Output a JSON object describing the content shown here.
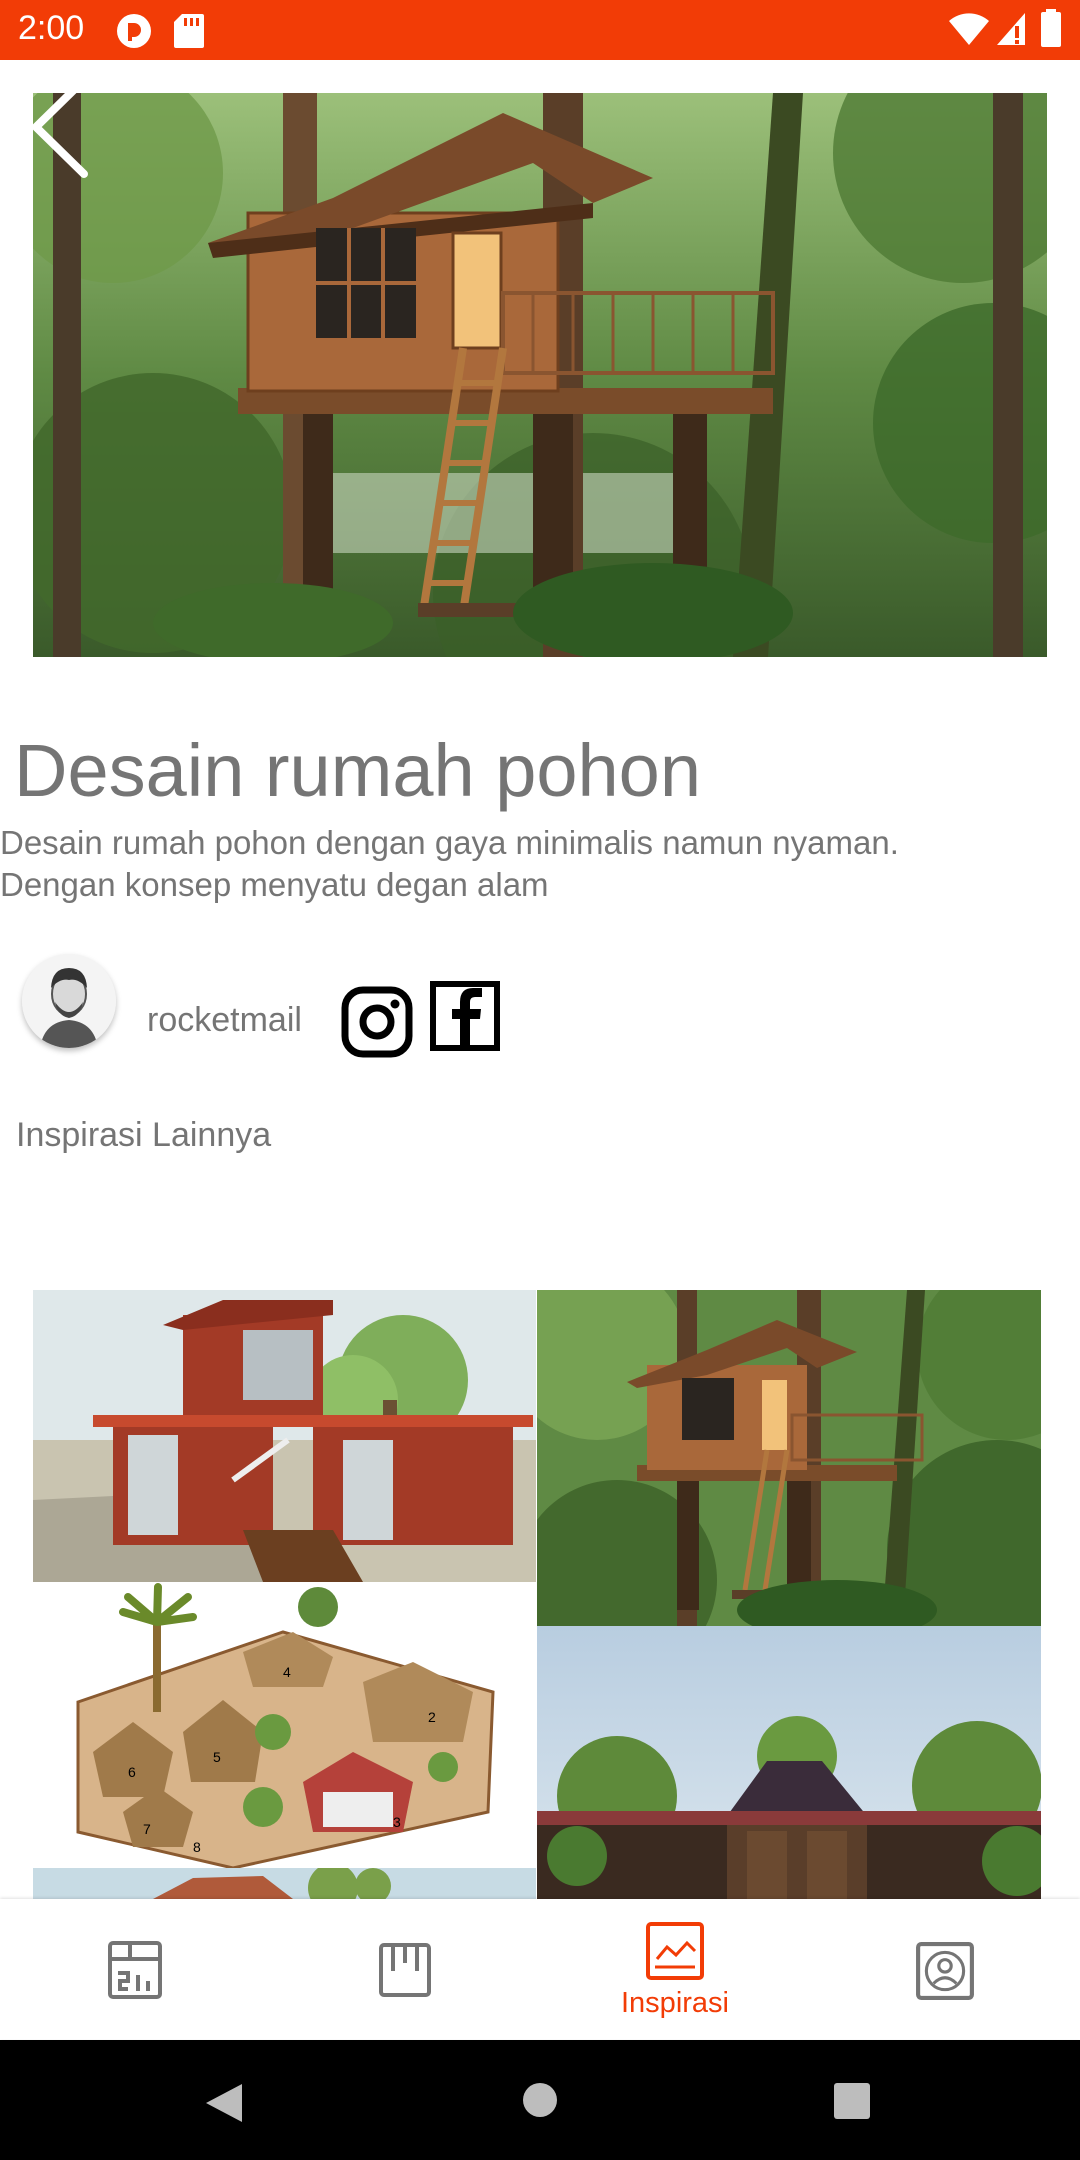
{
  "status_bar": {
    "time": "2:00",
    "background": "#f23c06",
    "left_icons": [
      "app-notification-icon",
      "sd-card-icon"
    ],
    "right_icons": [
      "wifi-icon",
      "cell-signal-icon",
      "battery-icon"
    ]
  },
  "detail": {
    "title": "Desain rumah pohon",
    "description_line1": "Desain rumah pohon dengan gaya minimalis namun nyaman.",
    "description_line2": "Dengan konsep menyatu degan alam",
    "author": "rocketmail",
    "social": [
      "instagram-icon",
      "facebook-icon"
    ]
  },
  "section": {
    "other_inspirations": "Inspirasi Lainnya"
  },
  "bottom_nav": {
    "items": [
      {
        "icon": "dashboard-icon",
        "label": ""
      },
      {
        "icon": "board-icon",
        "label": ""
      },
      {
        "icon": "chart-icon",
        "label": "Inspirasi",
        "active": true
      },
      {
        "icon": "profile-icon",
        "label": ""
      }
    ],
    "active_color": "#f23c06",
    "inactive_color": "#757575"
  },
  "colors": {
    "accent": "#f23c06",
    "text_gray": "#757575"
  }
}
